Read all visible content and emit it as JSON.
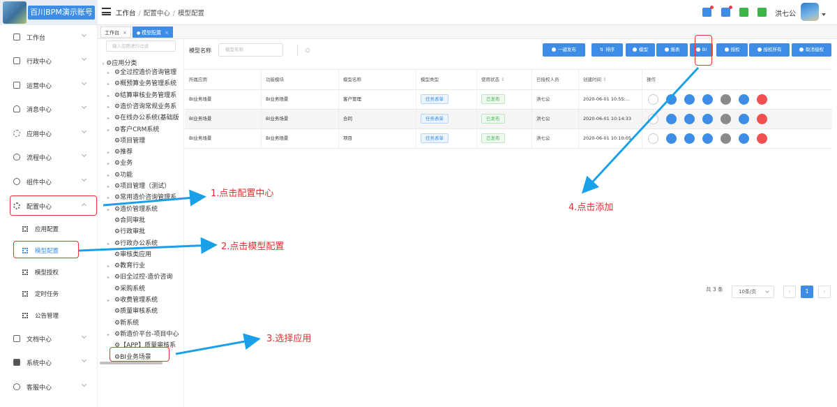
{
  "header": {
    "app_title": "百川BPM演示账号",
    "breadcrumb": [
      "工作台",
      "配置中心",
      "模型配置"
    ],
    "username": "洪七公",
    "colors": {
      "accent": "#3d8de6",
      "green": "#46b45a"
    }
  },
  "sidebar": {
    "items": [
      {
        "label": "工作台",
        "icon": "home-icon"
      },
      {
        "label": "行政中心",
        "icon": "building-icon"
      },
      {
        "label": "运营中心",
        "icon": "monitor-icon"
      },
      {
        "label": "消息中心",
        "icon": "bell-icon"
      },
      {
        "label": "应用中心",
        "icon": "app-icon"
      },
      {
        "label": "流程中心",
        "icon": "share-icon"
      },
      {
        "label": "组件中心",
        "icon": "component-icon"
      },
      {
        "label": "配置中心",
        "icon": "gear-icon"
      },
      {
        "label": "文档中心",
        "icon": "folder-icon"
      },
      {
        "label": "系统中心",
        "icon": "desktop-icon"
      },
      {
        "label": "客服中心",
        "icon": "user-icon"
      }
    ],
    "config_submenu": [
      "应用配置",
      "模型配置",
      "模型授权",
      "定时任务",
      "公告管理"
    ]
  },
  "tabs": [
    "工作台",
    "模型配置"
  ],
  "tree": {
    "filter_placeholder": "输入应用进行过滤",
    "root": "应用分类",
    "nodes": [
      "全过控造价咨询管理",
      "概预算业务管理系统",
      "结算审核业务管理系",
      "造价咨询常规业务系",
      "在线办公系统(基础版",
      "客户CRM系统",
      "项目管理",
      "推荐",
      "业务",
      "功能",
      "项目管理（测试）",
      "常用造价咨询管理系",
      "造价管理系统",
      "合同审批",
      "行政审批",
      "行政办公系统",
      "审核类应用",
      "教育行业",
      "旧全过控-造价咨询",
      "采购系统",
      "收费管理系统",
      "质量审核系统",
      "新系统",
      "新造价平台-项目中心",
      "【APP】质量审核系",
      "BI业务场景"
    ]
  },
  "toolbar": {
    "search_label": "模型名称",
    "search_placeholder": "模型名称",
    "buttons": [
      "一键发布",
      "排序",
      "模型",
      "报表",
      "BI",
      "授权",
      "授权所有",
      "取消授权"
    ]
  },
  "table": {
    "columns": [
      "所属应用",
      "功能模块",
      "模型名称",
      "模型类型",
      "使用状态",
      "已授权人员",
      "创建时间",
      "操作"
    ],
    "rows": [
      [
        "BI业务场景",
        "BI业务场景",
        "客户管理",
        "任务表单",
        "已发布",
        "洪七公",
        "2020-06-01 10:55:..."
      ],
      [
        "BI业务场景",
        "BI业务场景",
        "合同",
        "任务表单",
        "已发布",
        "洪七公",
        "2020-06-01 10:14:33"
      ],
      [
        "BI业务场景",
        "BI业务场景",
        "项目",
        "任务表单",
        "已发布",
        "洪七公",
        "2020-06-01 10:10:05"
      ]
    ]
  },
  "pagination": {
    "total": "共 3 条",
    "page_size": "10条/页",
    "current": "1"
  },
  "annotations": [
    "1.点击配置中心",
    "2.点击模型配置",
    "3.选择应用",
    "4.点击添加"
  ]
}
